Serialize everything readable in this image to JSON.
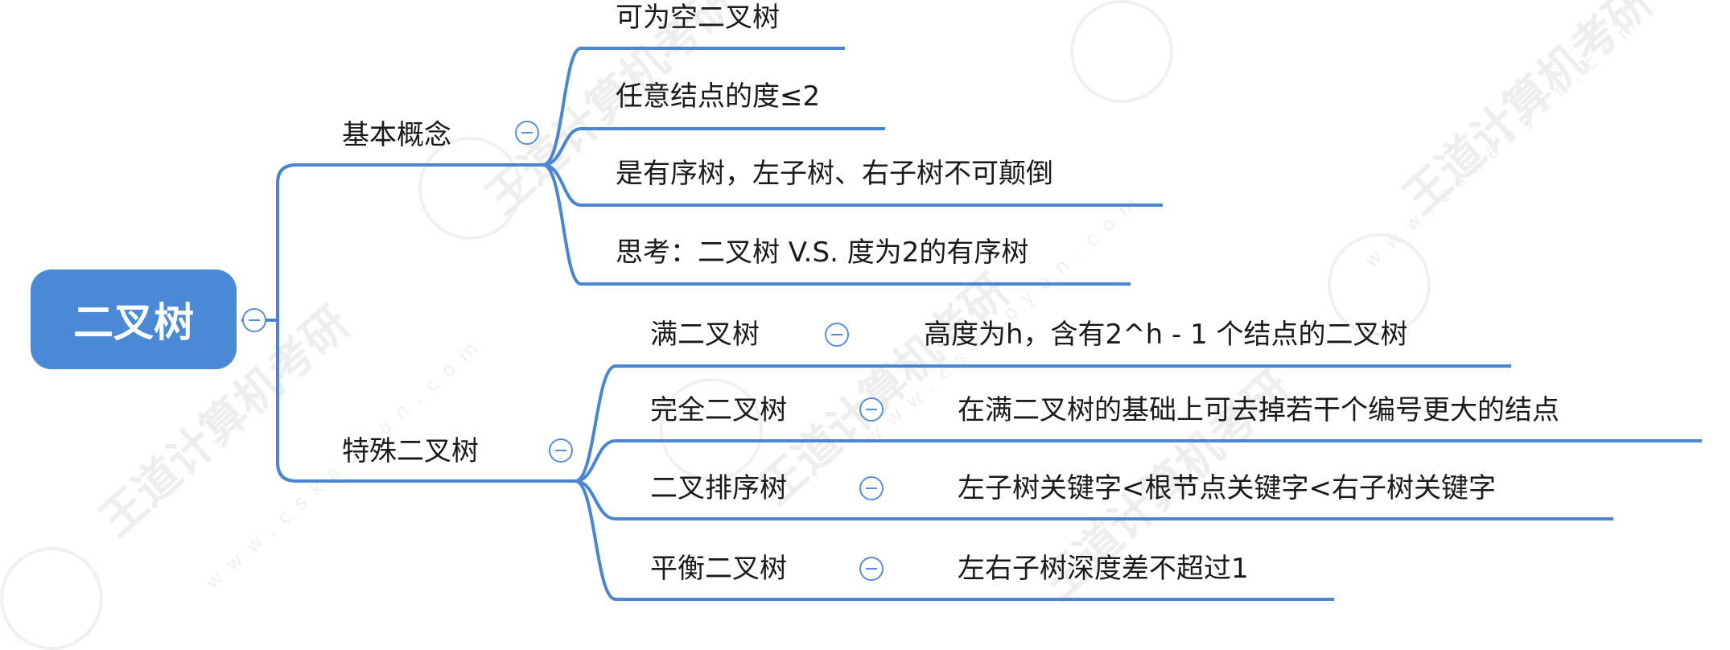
{
  "watermark": {
    "brand": "王道计算机考研",
    "site": "www.cskaoyan.com"
  },
  "root": {
    "label": "二叉树"
  },
  "basic": {
    "label": "基本概念",
    "items": [
      "可为空二叉树",
      "任意结点的度≤2",
      "是有序树，左子树、右子树不可颠倒",
      "思考：二叉树 V.S. 度为2的有序树"
    ]
  },
  "special": {
    "label": "特殊二叉树",
    "items": [
      {
        "name": "满二叉树",
        "desc": "高度为h，含有2^h - 1 个结点的二叉树"
      },
      {
        "name": "完全二叉树",
        "desc": "在满二叉树的基础上可去掉若干个编号更大的结点"
      },
      {
        "name": "二叉排序树",
        "desc": "左子树关键字<根节点关键字<右子树关键字"
      },
      {
        "name": "平衡二叉树",
        "desc": "左右子树深度差不超过1"
      }
    ]
  },
  "colors": {
    "line": "#4a86d0",
    "root_fill": "#4a89d6",
    "toggle": "#5b8fd4"
  }
}
